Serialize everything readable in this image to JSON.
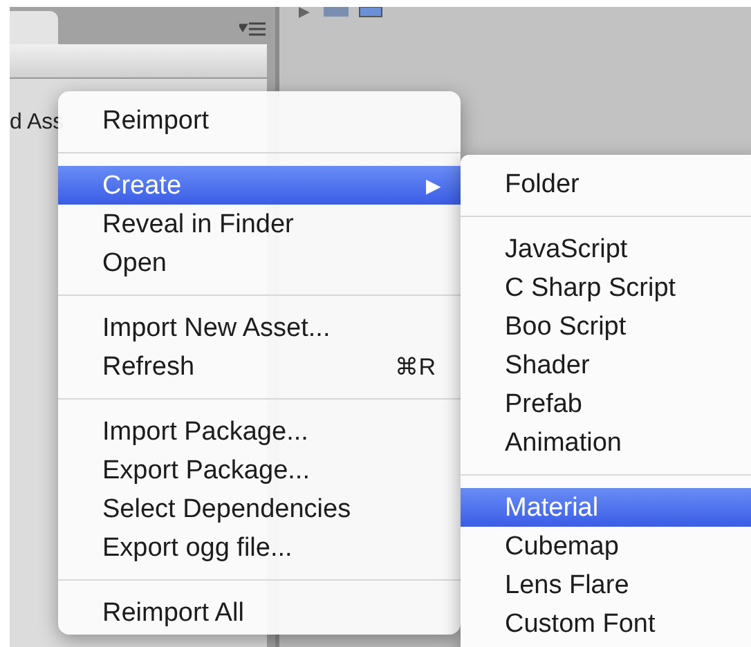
{
  "left_panel": {
    "partial_label": "d Ass"
  },
  "context_menu": {
    "items": [
      {
        "kind": "item",
        "label": "Reimport",
        "selected": false
      },
      {
        "kind": "separator"
      },
      {
        "kind": "item",
        "label": "Create",
        "selected": true,
        "submenu_arrow": "▶"
      },
      {
        "kind": "item",
        "label": "Reveal in Finder",
        "selected": false
      },
      {
        "kind": "item",
        "label": "Open",
        "selected": false
      },
      {
        "kind": "separator"
      },
      {
        "kind": "item",
        "label": "Import New Asset...",
        "selected": false
      },
      {
        "kind": "item",
        "label": "Refresh",
        "selected": false,
        "shortcut": "⌘R"
      },
      {
        "kind": "separator"
      },
      {
        "kind": "item",
        "label": "Import Package...",
        "selected": false
      },
      {
        "kind": "item",
        "label": "Export Package...",
        "selected": false
      },
      {
        "kind": "item",
        "label": "Select Dependencies",
        "selected": false
      },
      {
        "kind": "item",
        "label": "Export ogg file...",
        "selected": false
      },
      {
        "kind": "separator"
      },
      {
        "kind": "item",
        "label": "Reimport All",
        "selected": false
      }
    ]
  },
  "submenu": {
    "items": [
      {
        "kind": "item",
        "label": "Folder",
        "selected": false
      },
      {
        "kind": "separator"
      },
      {
        "kind": "item",
        "label": "JavaScript",
        "selected": false
      },
      {
        "kind": "item",
        "label": "C Sharp Script",
        "selected": false
      },
      {
        "kind": "item",
        "label": "Boo Script",
        "selected": false
      },
      {
        "kind": "item",
        "label": "Shader",
        "selected": false
      },
      {
        "kind": "item",
        "label": "Prefab",
        "selected": false
      },
      {
        "kind": "item",
        "label": "Animation",
        "selected": false
      },
      {
        "kind": "separator"
      },
      {
        "kind": "item",
        "label": "Material",
        "selected": true
      },
      {
        "kind": "item",
        "label": "Cubemap",
        "selected": false
      },
      {
        "kind": "item",
        "label": "Lens Flare",
        "selected": false
      },
      {
        "kind": "item",
        "label": "Custom Font",
        "selected": false
      }
    ]
  }
}
